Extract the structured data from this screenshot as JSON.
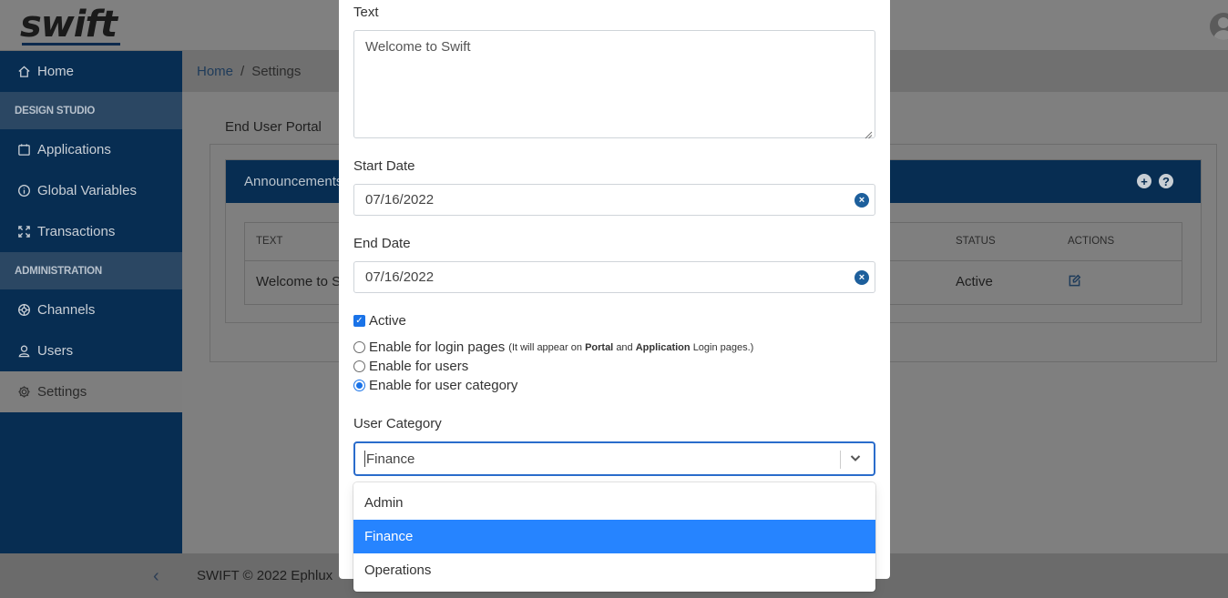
{
  "app": {
    "logo": "swift"
  },
  "sidebar": {
    "home": "Home",
    "sections": [
      "DESIGN STUDIO",
      "ADMINISTRATION"
    ],
    "design_items": [
      "Applications",
      "Global Variables",
      "Transactions"
    ],
    "admin_items": [
      "Channels",
      "Users",
      "Settings"
    ],
    "active": "Settings"
  },
  "breadcrumb": {
    "root": "Home",
    "separator": "/",
    "current": "Settings"
  },
  "page": {
    "tab": "End User Portal",
    "card_title": "Announcements",
    "table": {
      "headers": [
        "TEXT",
        "STATUS",
        "ACTIONS"
      ],
      "rows": [
        {
          "text": "Welcome to Swift",
          "status": "Active"
        }
      ]
    }
  },
  "footer": {
    "text": "SWIFT © 2022 Ephlux"
  },
  "modal": {
    "text_label": "Text",
    "text_value": "Welcome to Swift",
    "start_label": "Start Date",
    "start_value": "07/16/2022",
    "end_label": "End Date",
    "end_value": "07/16/2022",
    "active_label": "Active",
    "active_checked": true,
    "radio_login": "Enable for login pages",
    "radio_login_hint_1": "(It will appear on",
    "radio_login_hint_portal": "Portal",
    "radio_login_hint_and": "and",
    "radio_login_hint_app": "Application",
    "radio_login_hint_2": "Login pages.)",
    "radio_users": "Enable for users",
    "radio_category": "Enable for user category",
    "selected_radio": "Enable for user category",
    "category_label": "User Category",
    "category_value": "Finance",
    "options": [
      "Admin",
      "Finance",
      "Operations"
    ],
    "highlighted_option": "Finance"
  },
  "colors": {
    "sidebar": "#072d52",
    "accent": "#2684ff",
    "clear_button": "#1d5f9c"
  }
}
